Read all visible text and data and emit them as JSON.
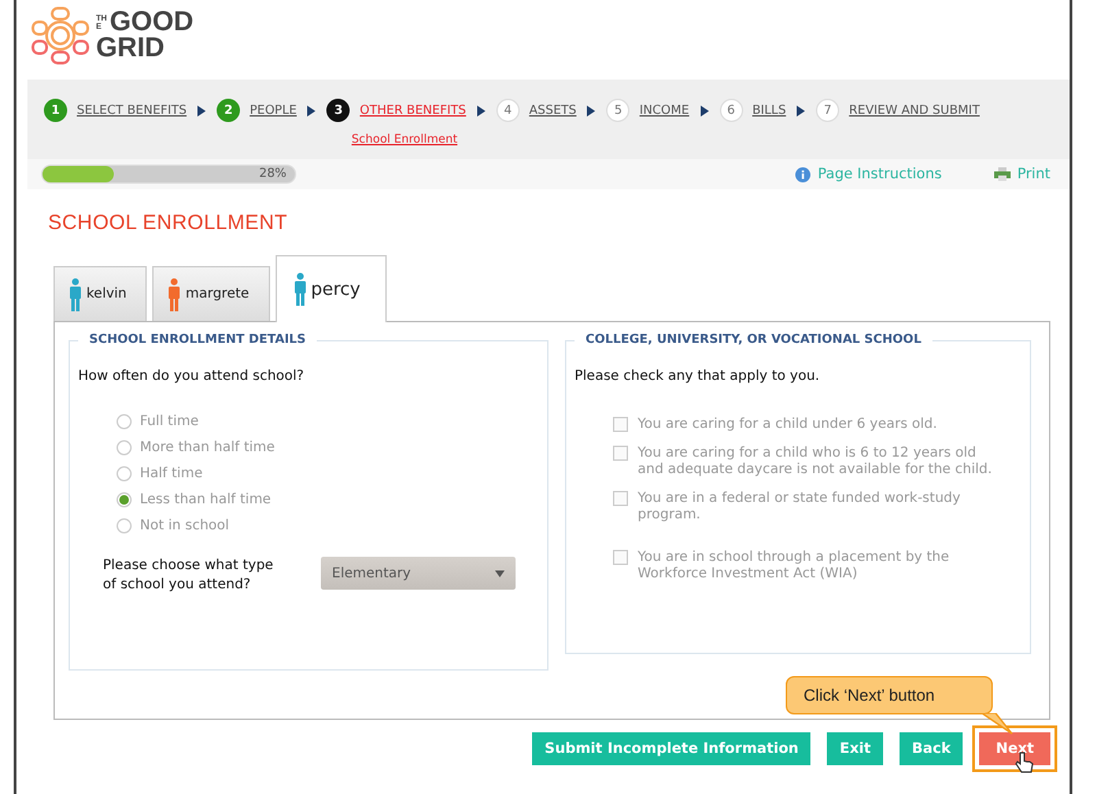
{
  "logo": {
    "small": "THE",
    "line1": "GOOD",
    "line2": "GRID"
  },
  "steps": [
    {
      "number": "1",
      "label": "SELECT BENEFITS",
      "completed": true,
      "selected": false
    },
    {
      "number": "2",
      "label": "PEOPLE",
      "completed": true,
      "selected": false
    },
    {
      "number": "3",
      "label": "OTHER BENEFITS",
      "completed": false,
      "selected": true,
      "sublabel": "School Enrollment"
    },
    {
      "number": "4",
      "label": "ASSETS",
      "completed": false,
      "selected": false
    },
    {
      "number": "5",
      "label": "INCOME",
      "completed": false,
      "selected": false
    },
    {
      "number": "6",
      "label": "BILLS",
      "completed": false,
      "selected": false
    },
    {
      "number": "7",
      "label": "REVIEW AND SUBMIT",
      "completed": false,
      "selected": false
    }
  ],
  "progress": {
    "level": 0.28,
    "reading": "28%"
  },
  "links": [
    {
      "kind": "info",
      "label": "Page Instructions"
    },
    {
      "kind": "print",
      "label": "Print"
    }
  ],
  "title": "SCHOOL ENROLLMENT",
  "tabs": [
    {
      "label": "kelvin",
      "color": "#2aa8c8",
      "selected": false
    },
    {
      "label": "margrete",
      "color": "#f26b2d",
      "selected": false
    },
    {
      "label": "percy",
      "color": "#2aa8c8",
      "selected": true
    }
  ],
  "details": {
    "legend": "SCHOOL ENROLLMENT DETAILS",
    "question": "How often do you attend school?",
    "options": [
      {
        "label": "Full time",
        "selected": false
      },
      {
        "label": "More than half time",
        "selected": false
      },
      {
        "label": "Half time",
        "selected": false
      },
      {
        "label": "Less than half time",
        "selected": true
      },
      {
        "label": "Not in school",
        "selected": false
      }
    ],
    "select_label": "Please choose what type of school you attend?",
    "select_value": "Elementary"
  },
  "college": {
    "legend": "COLLEGE, UNIVERSITY, OR VOCATIONAL SCHOOL",
    "question": "Please check any that apply to you.",
    "items": [
      {
        "label": "You are caring for a child under 6 years old.",
        "checked": false
      },
      {
        "label": "You are caring for a child who is 6 to 12 years old and adequate daycare is not available for the child.",
        "checked": false
      },
      {
        "label": "You are in a federal or state funded work-study program.",
        "checked": false
      },
      {
        "label": "You are in school through a placement by the Workforce Investment Act (WIA)",
        "checked": false
      }
    ]
  },
  "buttons": [
    {
      "label": "Submit Incomplete Information",
      "kind": "secondary"
    },
    {
      "label": "Exit",
      "kind": "secondary"
    },
    {
      "label": "Back",
      "kind": "secondary"
    },
    {
      "label": "Next",
      "kind": "primary",
      "highlighted": true
    }
  ],
  "callout": "Click ‘Next’ button"
}
